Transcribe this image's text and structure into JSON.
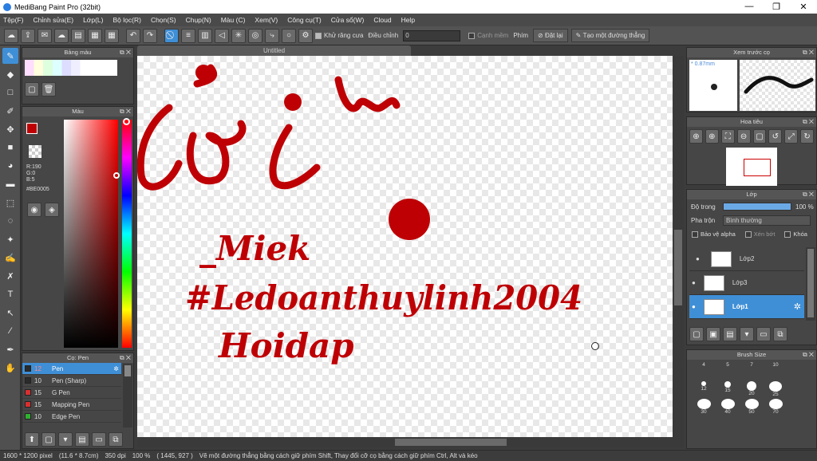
{
  "title": "MediBang Paint Pro (32bit)",
  "window_buttons": [
    "—",
    "❐",
    "✕"
  ],
  "menu": [
    "Tệp(F)",
    "Chỉnh sửa(E)",
    "Lớp(L)",
    "Bộ lọc(R)",
    "Chọn(S)",
    "Chụp(N)",
    "Màu (C)",
    "Xem(V)",
    "Công cụ(T)",
    "Cửa sổ(W)",
    "Cloud",
    "Help"
  ],
  "toolbar": {
    "antialias": "Khử răng cưa",
    "adjust": "Điều chỉnh",
    "adjust_value": "0",
    "smooth": "Cạnh mềm",
    "key": "Phím",
    "reset": "Đặt lại",
    "make_line": "Tạo một đường thẳng"
  },
  "doc": {
    "tab": "Untitled"
  },
  "panels": {
    "palette": "Bảng màu",
    "color": "Màu",
    "brush": "Cọ: Pen",
    "preview": "Xem trước cọ",
    "navigator": "Hoa tiêu",
    "layer": "Lớp",
    "brush_size": "Brush Size"
  },
  "color": {
    "r": "R:190",
    "g": "G:0",
    "b": "B:5",
    "hex": "#BE0005",
    "primary": "#BE0005"
  },
  "preview_size": "0.87mm",
  "brushes": [
    {
      "size": "12",
      "name": "Pen",
      "color": "#2b2b2b"
    },
    {
      "size": "10",
      "name": "Pen (Sharp)",
      "color": "#2b2b2b"
    },
    {
      "size": "15",
      "name": "G Pen",
      "color": "#d83030"
    },
    {
      "size": "15",
      "name": "Mapping Pen",
      "color": "#d83030"
    },
    {
      "size": "10",
      "name": "Edge Pen",
      "color": "#30b030"
    }
  ],
  "layer": {
    "opacity_label": "Độ trong",
    "opacity": "100 %",
    "blend_label": "Pha trộn",
    "blend": "Bình thường",
    "protect_alpha": "Bảo vệ alpha",
    "clip": "Xén bớt",
    "lock": "Khóa",
    "layers": [
      {
        "name": "Lớp2"
      },
      {
        "name": "Lớp3"
      },
      {
        "name": "Lớp1"
      }
    ]
  },
  "brush_sizes": [
    "4",
    "5",
    "7",
    "10",
    "12",
    "15",
    "20",
    "25",
    "30",
    "40",
    "50",
    "70"
  ],
  "canvas_text": {
    "line1": "ươi",
    "line2": "_Miek",
    "line3": "#Ledoanthuylinh2004",
    "line4": "Hoidap"
  },
  "status": {
    "size": "1600 * 1200 pixel",
    "cm": "(11.6 * 8.7cm)",
    "dpi": "350 dpi",
    "zoom": "100 %",
    "coords": "( 1445, 927 )",
    "hint": "Vẽ một đường thẳng bằng cách giữ phím Shift, Thay đổi cỡ cọ bằng cách giữ phím Ctrl, Alt và kéo"
  }
}
